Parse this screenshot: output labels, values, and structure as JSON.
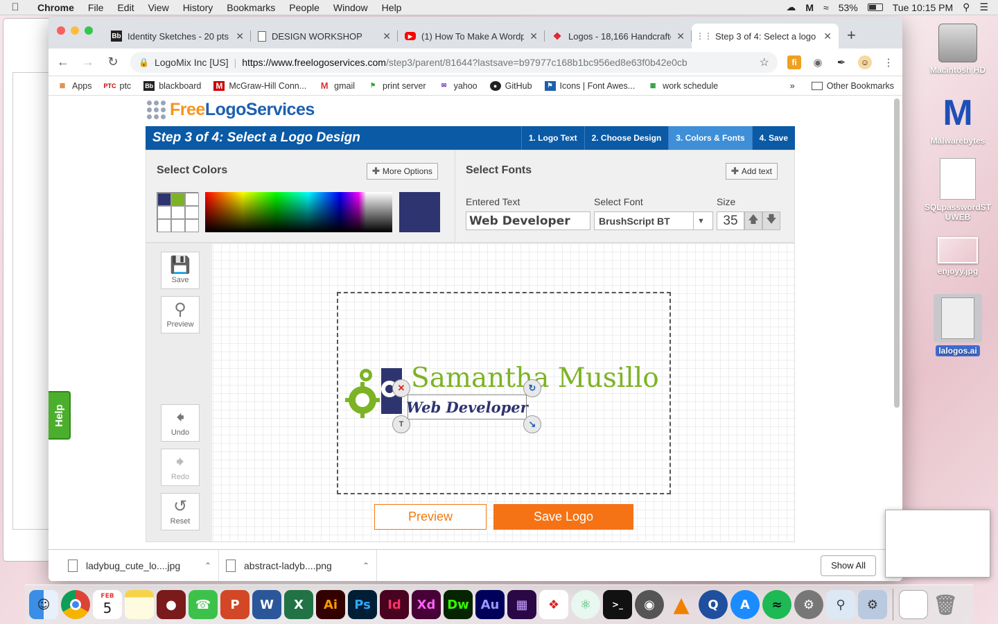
{
  "menubar": {
    "app": "Chrome",
    "items": [
      "File",
      "Edit",
      "View",
      "History",
      "Bookmarks",
      "People",
      "Window",
      "Help"
    ],
    "battery": "53%",
    "clock": "Tue 10:15 PM"
  },
  "tabs": [
    {
      "label": "Identity Sketches - 20 pts",
      "icon": "Bb"
    },
    {
      "label": "DESIGN WORKSHOP",
      "icon": "doc"
    },
    {
      "label": "(1) How To Make A Wordp",
      "icon": "yt"
    },
    {
      "label": "Logos - 18,166 Handcrafte",
      "icon": "logos"
    },
    {
      "label": "Step 3 of 4: Select a logo",
      "icon": "dots"
    }
  ],
  "omnibox": {
    "org": "LogoMix Inc [US]",
    "url_host": "https://www.freelogoservices.com",
    "url_path": "/step3/parent/81644?lastsave=b97977c168b1bc956ed8e63f0b42e0cb"
  },
  "bookmarks": [
    {
      "label": "Apps",
      "icon": "apps"
    },
    {
      "label": "ptc",
      "icon": "PTC"
    },
    {
      "label": "blackboard",
      "icon": "Bb"
    },
    {
      "label": "McGraw-Hill Conn...",
      "icon": "M"
    },
    {
      "label": "gmail",
      "icon": "gmail"
    },
    {
      "label": "print server",
      "icon": "print"
    },
    {
      "label": "yahoo",
      "icon": "yahoo"
    },
    {
      "label": "GitHub",
      "icon": "github"
    },
    {
      "label": "Icons | Font Awes...",
      "icon": "fa"
    },
    {
      "label": "work schedule",
      "icon": "grid"
    }
  ],
  "bookmarks_more": "»",
  "bookmarks_other": "Other Bookmarks",
  "site": {
    "brand_free": "Free",
    "brand_rest": "LogoServices",
    "step_title": "Step 3 of 4: Select a Logo Design",
    "steps": [
      "1. Logo Text",
      "2. Choose Design",
      "3. Colors & Fonts",
      "4. Save"
    ],
    "colors_title": "Select Colors",
    "more_options": "More Options",
    "fonts_title": "Select Fonts",
    "add_text": "Add text",
    "entered_text_label": "Entered Text",
    "entered_text_value": "Web Developer",
    "select_font_label": "Select Font",
    "select_font_value": "BrushScript BT",
    "size_label": "Size",
    "size_value": "35",
    "tools": [
      "Save",
      "Preview",
      "Undo",
      "Redo",
      "Reset"
    ],
    "logo_name": "Samantha Musillo",
    "logo_tagline": "Web Developer",
    "preview_button": "Preview",
    "save_logo_button": "Save Logo",
    "help": "Help",
    "colors": {
      "primary": "#2e3470",
      "accent": "#7cb325",
      "orange": "#f57315",
      "bar": "#0a5aa5"
    }
  },
  "downloads": [
    {
      "name": "ladybug_cute_lo....jpg"
    },
    {
      "name": "abstract-ladyb....png"
    }
  ],
  "show_all": "Show All",
  "desktop_icons": [
    {
      "label": "Macintosh HD",
      "icon": "hdd-icon"
    },
    {
      "label": "Malwarebytes",
      "icon": "malwarebytes-icon"
    },
    {
      "label": "SQLpasswordSTUWEB",
      "icon": "document-icon"
    },
    {
      "label": "enjoyy.jpg",
      "icon": "image-icon"
    },
    {
      "label": "lalogos.ai",
      "icon": "ai-file-icon"
    }
  ],
  "dock": [
    "Finder",
    "Chrome",
    "Calendar",
    "Notes",
    "Photo Booth",
    "FaceTime",
    "PowerPoint",
    "Word",
    "Excel",
    "Ai",
    "Ps",
    "Id",
    "Xd",
    "Dw",
    "Au",
    "Premiere",
    "Acrobat",
    "Atom",
    "Terminal",
    "Sequel",
    "VLC",
    "QuickTime",
    "App Store",
    "Spotify",
    "System Preferences",
    "Preview",
    "Xcode",
    "Trash"
  ],
  "dock_calendar_month": "FEB",
  "dock_calendar_day": "5"
}
